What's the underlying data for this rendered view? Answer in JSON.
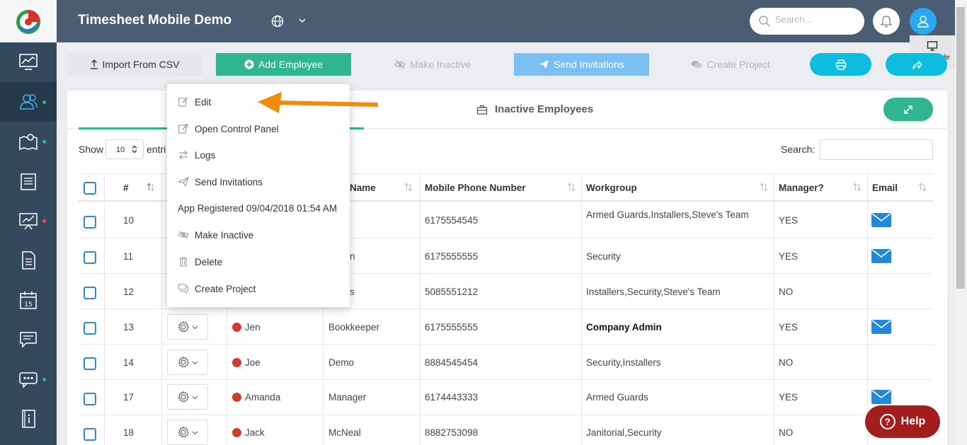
{
  "header": {
    "title": "Timesheet Mobile Demo",
    "search_placeholder": "Search...",
    "page_guide": "page guide"
  },
  "toolbar": {
    "import": "Import From CSV",
    "add_employee": "Add Employee",
    "make_inactive": "Make Inactive",
    "send_invitations": "Send Invitations",
    "create_project": "Create Project"
  },
  "tabs": {
    "inactive": "Inactive Employees"
  },
  "controls": {
    "show": "Show",
    "show_value": "10",
    "entries": "entri",
    "search": "Search:"
  },
  "table": {
    "headers": {
      "num": "#",
      "last_name": "Name",
      "mobile": "Mobile Phone Number",
      "workgroup": "Workgroup",
      "manager": "Manager?",
      "email": "Email"
    },
    "rows": [
      {
        "num": "10",
        "first": "",
        "last": "",
        "mobile": "6175554545",
        "workgroup": "Armed Guards,Installers,Steve's Team",
        "manager": "YES",
        "email": true
      },
      {
        "num": "11",
        "first": "",
        "last": "n",
        "mobile": "6175555555",
        "workgroup": "Security",
        "manager": "YES",
        "email": true
      },
      {
        "num": "12",
        "first": "",
        "last": "s",
        "mobile": "5085551212",
        "workgroup": "Installers,Security,Steve's Team",
        "manager": "NO",
        "email": false
      },
      {
        "num": "13",
        "first": "Jen",
        "last": "Bookkeeper",
        "mobile": "6175555555",
        "workgroup": "Company Admin",
        "manager": "YES",
        "email": true
      },
      {
        "num": "14",
        "first": "Joe",
        "last": "Demo",
        "mobile": "8884545454",
        "workgroup": "Security,Installers",
        "manager": "NO",
        "email": false
      },
      {
        "num": "17",
        "first": "Amanda",
        "last": "Manager",
        "mobile": "6174443333",
        "workgroup": "Armed Guards",
        "manager": "YES",
        "email": true
      },
      {
        "num": "18",
        "first": "Jack",
        "last": "McNeal",
        "mobile": "8882753098",
        "workgroup": "Janitorial,Security",
        "manager": "NO",
        "email": false
      }
    ]
  },
  "dropdown": {
    "edit": "Edit",
    "control_panel": "Open Control Panel",
    "logs": "Logs",
    "send_invitations": "Send Invitations",
    "app_registered": "App Registered 09/04/2018 01:54 AM",
    "make_inactive": "Make Inactive",
    "delete": "Delete",
    "create_project": "Create Project"
  },
  "help": "Help",
  "colors": {
    "sidebar": "#34495e",
    "header": "#4a5d72",
    "accent_green": "#2fb58f",
    "accent_cyan": "#0dbddf",
    "arrow_orange": "#f28a0a",
    "help_red": "#a31d1d"
  }
}
